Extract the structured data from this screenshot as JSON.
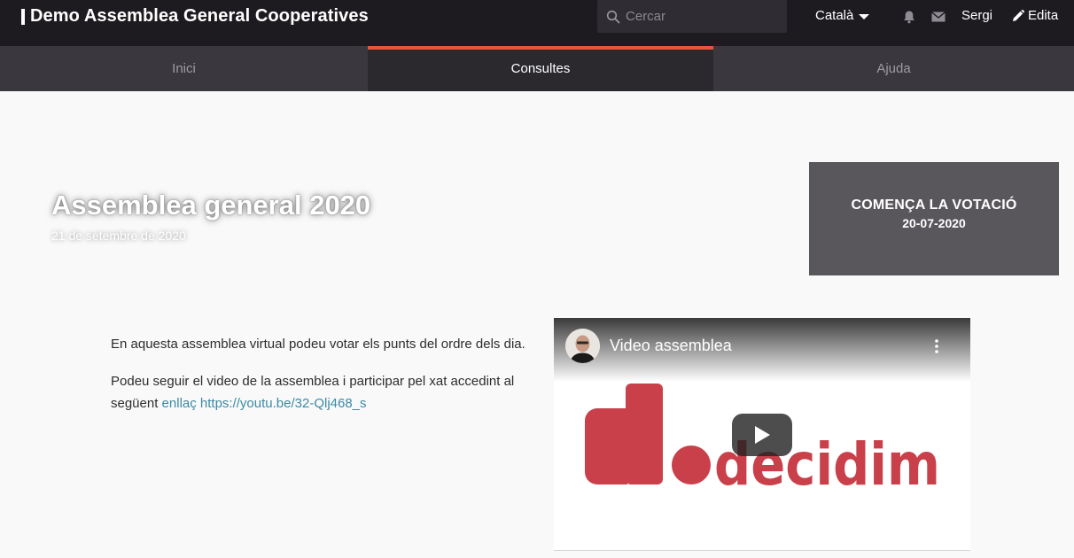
{
  "header": {
    "org_title": "Demo Assemblea General Cooperatives",
    "search_placeholder": "Cercar",
    "language": "Català",
    "user": "Sergi",
    "edit_label": "Edita"
  },
  "nav": {
    "tabs": [
      {
        "label": "Inici",
        "active": false
      },
      {
        "label": "Consultes",
        "active": true
      },
      {
        "label": "Ajuda",
        "active": false
      }
    ]
  },
  "hero": {
    "title": "Assemblea general 2020",
    "date": "21 de setembre de 2020",
    "vote_label": "COMENÇA LA VOTACIÓ",
    "vote_date": "20-07-2020"
  },
  "body": {
    "paragraph1": "En aquesta assemblea virtual podeu votar els punts del ordre dels dia.",
    "paragraph2_text": "Podeu seguir el video de la assemblea i participar pel xat accedint al següent ",
    "paragraph2_link": "enllaç https://youtu.be/32-Qlj468_s"
  },
  "video": {
    "title": "Video assemblea",
    "logo_text": "decidim"
  },
  "colors": {
    "topbar": "#1d1b1f",
    "nav": "#3a383e",
    "active_tab_accent": "#e6553b",
    "vote_box": "#5a575c",
    "link": "#3b8aa6",
    "decidim_red": "#c9404a"
  },
  "icons": {
    "search": "search-icon",
    "caret": "caret-down-icon",
    "bell": "bell-icon",
    "mail": "mail-icon",
    "edit": "pencil-icon",
    "menu": "more-vertical-icon",
    "play": "play-icon"
  }
}
